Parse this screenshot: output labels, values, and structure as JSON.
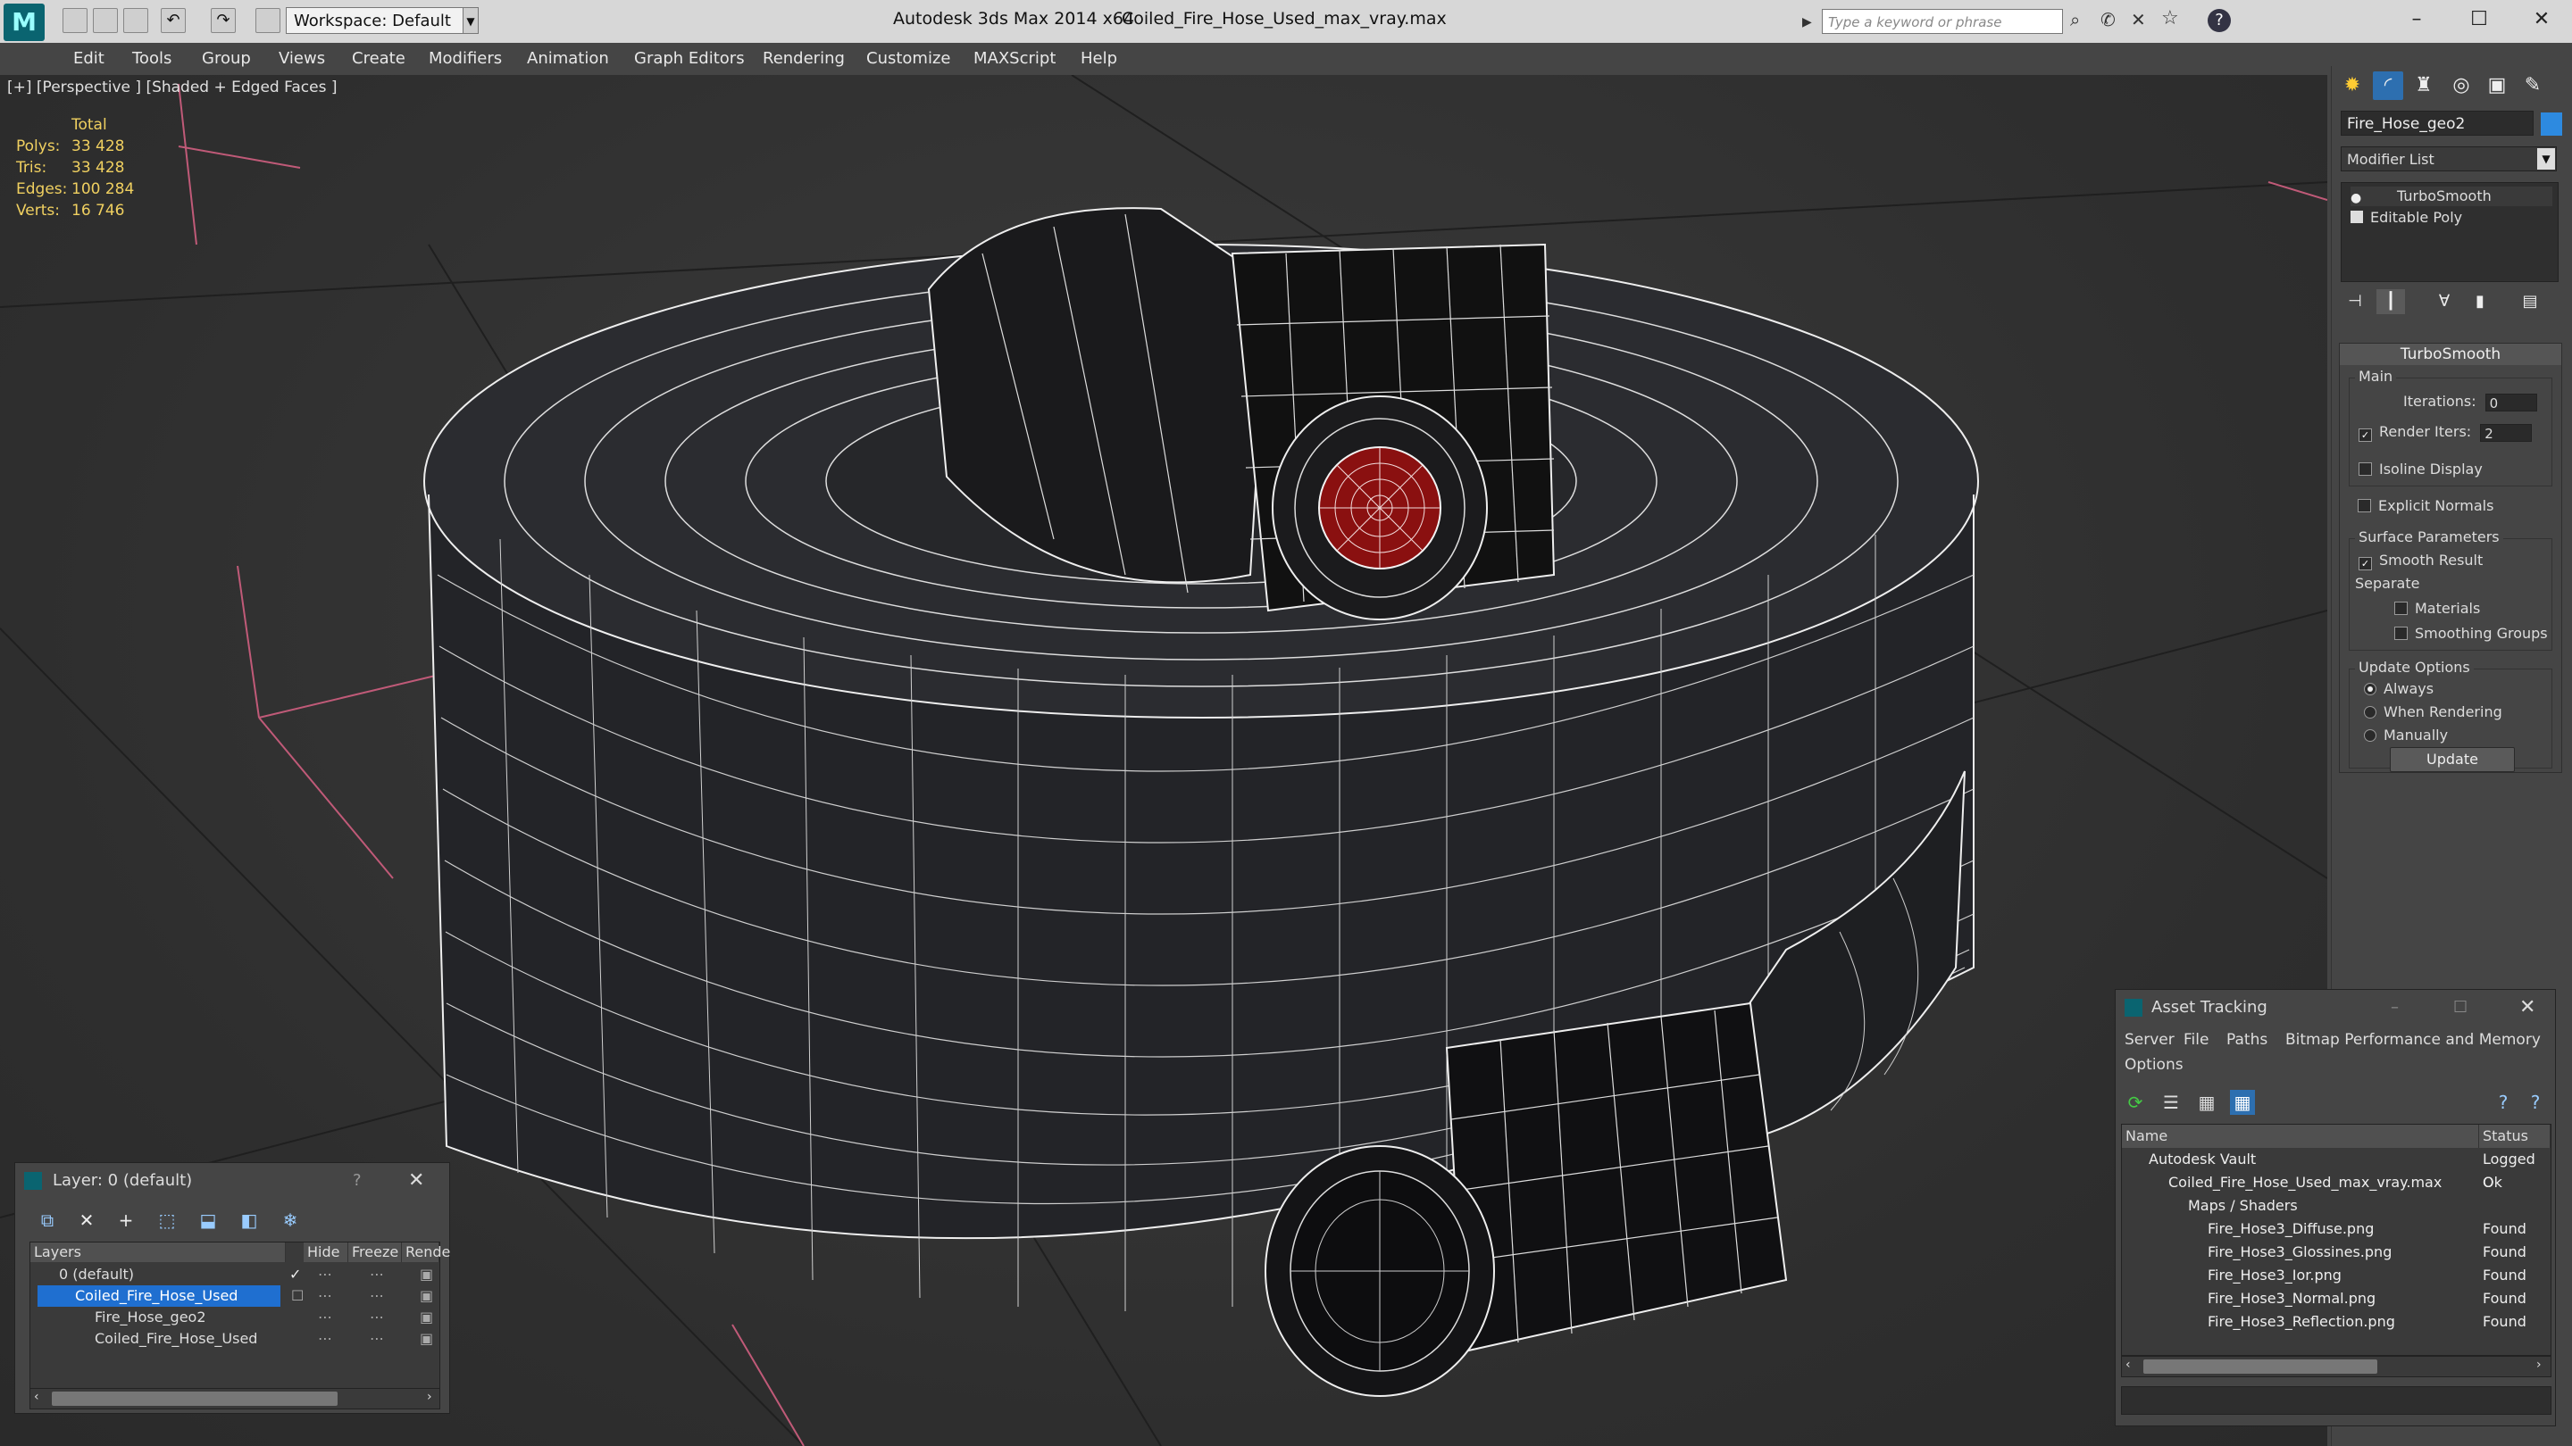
{
  "titlebar": {
    "app": "Autodesk 3ds Max  2014 x64",
    "file": "Coiled_Fire_Hose_Used_max_vray.max",
    "workspace": "Workspace: Default",
    "search_placeholder": "Type a keyword or phrase"
  },
  "menu": [
    "Edit",
    "Tools",
    "Group",
    "Views",
    "Create",
    "Modifiers",
    "Animation",
    "Graph Editors",
    "Rendering",
    "Customize",
    "MAXScript",
    "Help"
  ],
  "viewport": {
    "label": "[+] [Perspective ] [Shaded + Edged Faces ]",
    "stats": {
      "header": "Total",
      "rows": [
        {
          "k": "Polys:",
          "v": "33 428"
        },
        {
          "k": "Tris:",
          "v": "33 428"
        },
        {
          "k": "Edges:",
          "v": "100 284"
        },
        {
          "k": "Verts:",
          "v": "16 746"
        }
      ]
    }
  },
  "command_panel": {
    "object_name": "Fire_Hose_geo2",
    "modifier_list": "Modifier List",
    "stack": [
      "TurboSmooth",
      "Editable Poly"
    ],
    "rollout_title": "TurboSmooth",
    "main_label": "Main",
    "iterations_label": "Iterations:",
    "iterations_value": "0",
    "render_iters_label": "Render Iters:",
    "render_iters_value": "2",
    "isoline": "Isoline Display",
    "explicit_normals": "Explicit Normals",
    "surface_params": "Surface Parameters",
    "smooth_result": "Smooth Result",
    "separate": "Separate",
    "materials": "Materials",
    "smoothing_groups": "Smoothing Groups",
    "update_options": "Update Options",
    "always": "Always",
    "when_rendering": "When Rendering",
    "manually": "Manually",
    "update_button": "Update"
  },
  "layer_panel": {
    "title": "Layer: 0 (default)",
    "help": "?",
    "columns": [
      "Layers",
      "Hide",
      "Freeze",
      "Rende"
    ],
    "rows": [
      "0 (default)",
      "Coiled_Fire_Hose_Used",
      "Fire_Hose_geo2",
      "Coiled_Fire_Hose_Used"
    ]
  },
  "asset_panel": {
    "title": "Asset Tracking",
    "menu": [
      "Server",
      "File",
      "Paths",
      "Bitmap Performance and Memory",
      "Options"
    ],
    "columns": [
      "Name",
      "Status"
    ],
    "rows": [
      {
        "name": "Autodesk Vault",
        "status": "Logged O"
      },
      {
        "name": "Coiled_Fire_Hose_Used_max_vray.max",
        "status": "Ok"
      },
      {
        "name": "Maps / Shaders",
        "status": ""
      },
      {
        "name": "Fire_Hose3_Diffuse.png",
        "status": "Found"
      },
      {
        "name": "Fire_Hose3_Glossines.png",
        "status": "Found"
      },
      {
        "name": "Fire_Hose3_Ior.png",
        "status": "Found"
      },
      {
        "name": "Fire_Hose3_Normal.png",
        "status": "Found"
      },
      {
        "name": "Fire_Hose3_Reflection.png",
        "status": "Found"
      }
    ]
  },
  "colors": {
    "accent": "#2d8ae0",
    "selection": "#1f6fd0",
    "stats": "#f0d060",
    "nozzle_red": "#8a1010"
  }
}
